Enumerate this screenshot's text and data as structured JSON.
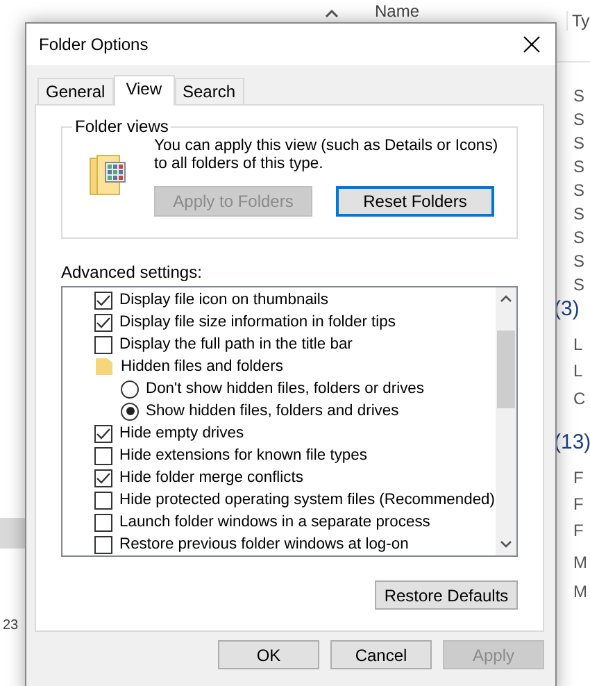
{
  "background": {
    "column_header": "Name",
    "column_header_2": "Ty",
    "right_column": [
      "S",
      "S",
      "S",
      "S",
      "S",
      "S",
      "S",
      "S",
      "S",
      "(3)",
      "L",
      "L",
      "C",
      "(13)",
      "F",
      "F",
      "F",
      "M",
      "M"
    ],
    "left_text": "23"
  },
  "window": {
    "title": "Folder Options"
  },
  "tabs": [
    {
      "label": "General",
      "selected": false
    },
    {
      "label": "View",
      "selected": true
    },
    {
      "label": "Search",
      "selected": false
    }
  ],
  "folder_views": {
    "title": "Folder views",
    "description": "You can apply this view (such as Details or Icons) to all folders of this type.",
    "buttons": [
      {
        "label": "Apply to Folders",
        "disabled": true,
        "focused": false
      },
      {
        "label": "Reset Folders",
        "disabled": false,
        "focused": true
      }
    ]
  },
  "advanced": {
    "label": "Advanced settings:",
    "items": [
      {
        "kind": "checkbox",
        "label": "Display file icon on thumbnails",
        "checked": true
      },
      {
        "kind": "checkbox",
        "label": "Display file size information in folder tips",
        "checked": true
      },
      {
        "kind": "checkbox",
        "label": "Display the full path in the title bar",
        "checked": false
      },
      {
        "kind": "folder",
        "label": "Hidden files and folders"
      },
      {
        "kind": "radio",
        "label": "Don't show hidden files, folders or drives",
        "selected": false
      },
      {
        "kind": "radio",
        "label": "Show hidden files, folders and drives",
        "selected": true
      },
      {
        "kind": "checkbox",
        "label": "Hide empty drives",
        "checked": true
      },
      {
        "kind": "checkbox",
        "label": "Hide extensions for known file types",
        "checked": false
      },
      {
        "kind": "checkbox",
        "label": "Hide folder merge conflicts",
        "checked": true
      },
      {
        "kind": "checkbox",
        "label": "Hide protected operating system files (Recommended)",
        "checked": false
      },
      {
        "kind": "checkbox",
        "label": "Launch folder windows in a separate process",
        "checked": false
      },
      {
        "kind": "checkbox",
        "label": "Restore previous folder windows at log-on",
        "checked": false
      }
    ],
    "restore_button": "Restore Defaults"
  },
  "buttons": [
    {
      "label": "OK",
      "disabled": false
    },
    {
      "label": "Cancel",
      "disabled": false
    },
    {
      "label": "Apply",
      "disabled": true
    }
  ]
}
